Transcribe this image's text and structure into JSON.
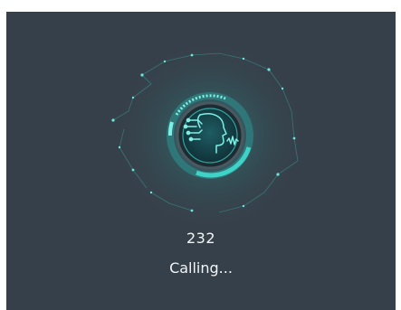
{
  "call": {
    "number": "232",
    "status": "Calling..."
  },
  "icons": {
    "caller_graphic": "face-recognition-icon"
  },
  "colors": {
    "background": "#36404a",
    "accent": "#3fd3c8",
    "text": "#f2f5f7"
  }
}
